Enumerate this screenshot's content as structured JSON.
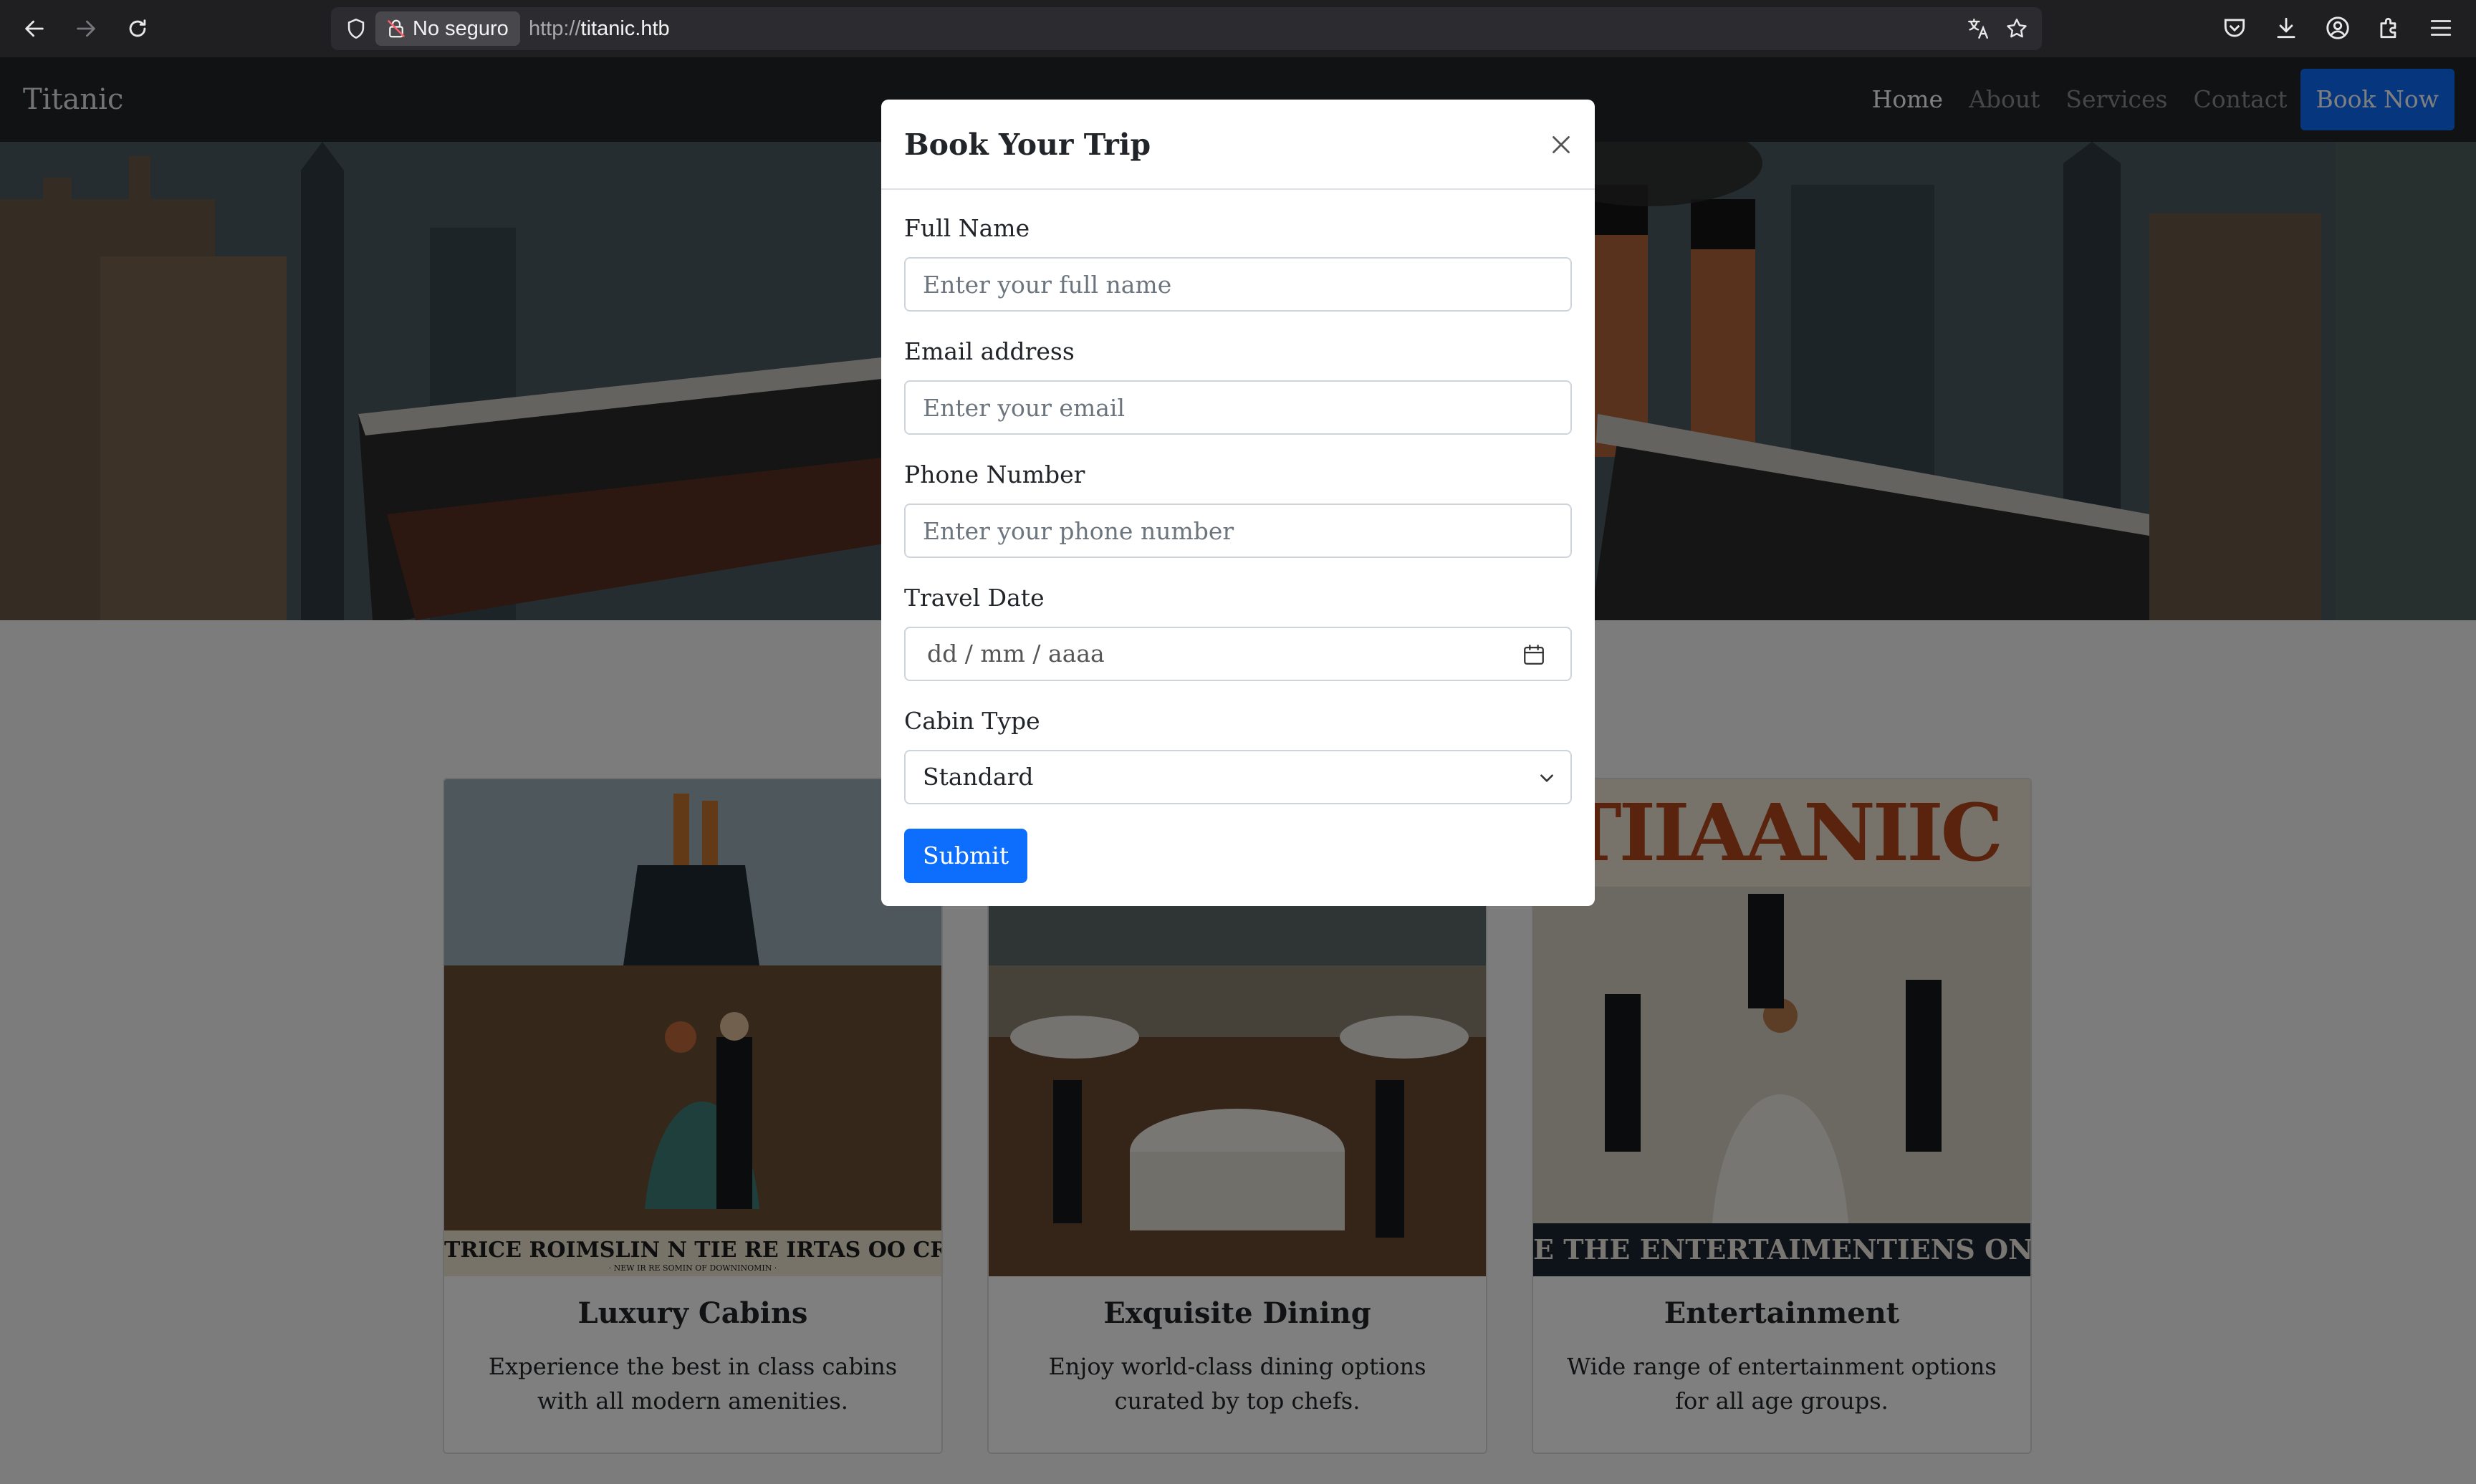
{
  "browser": {
    "security_label": "No seguro",
    "url_protocol": "http://",
    "url_host": "titanic.htb"
  },
  "navbar": {
    "brand": "Titanic",
    "links": [
      "Home",
      "About",
      "Services",
      "Contact"
    ],
    "active_link": "Home",
    "cta": "Book Now"
  },
  "cards": [
    {
      "title": "Luxury Cabins",
      "text": "Experience the best in class cabins with all modern amenities.",
      "banner": "TRICE ROIMSLIN N TIE RE IRTAS OO CRAS",
      "sub_banner": "· NEW IR RE SOMIN OF DOWNINOMIN ·"
    },
    {
      "title": "Exquisite Dining",
      "text": "Enjoy world-class dining options curated by top chefs."
    },
    {
      "title": "Entertainment",
      "text": "Wide range of entertainment options for all age groups.",
      "poster_title": "TIIAANIIC",
      "banner": "E THE ENTERTAIMENTIENS ON LA"
    }
  ],
  "modal": {
    "title": "Book Your Trip",
    "fields": {
      "full_name": {
        "label": "Full Name",
        "placeholder": "Enter your full name"
      },
      "email": {
        "label": "Email address",
        "placeholder": "Enter your email"
      },
      "phone": {
        "label": "Phone Number",
        "placeholder": "Enter your phone number"
      },
      "travel_date": {
        "label": "Travel Date",
        "placeholder": "dd / mm / aaaa"
      },
      "cabin_type": {
        "label": "Cabin Type",
        "value": "Standard"
      }
    },
    "submit": "Submit"
  },
  "colors": {
    "primary": "#0d6efd",
    "navbar": "#212529",
    "chrome": "#1f1f22"
  }
}
